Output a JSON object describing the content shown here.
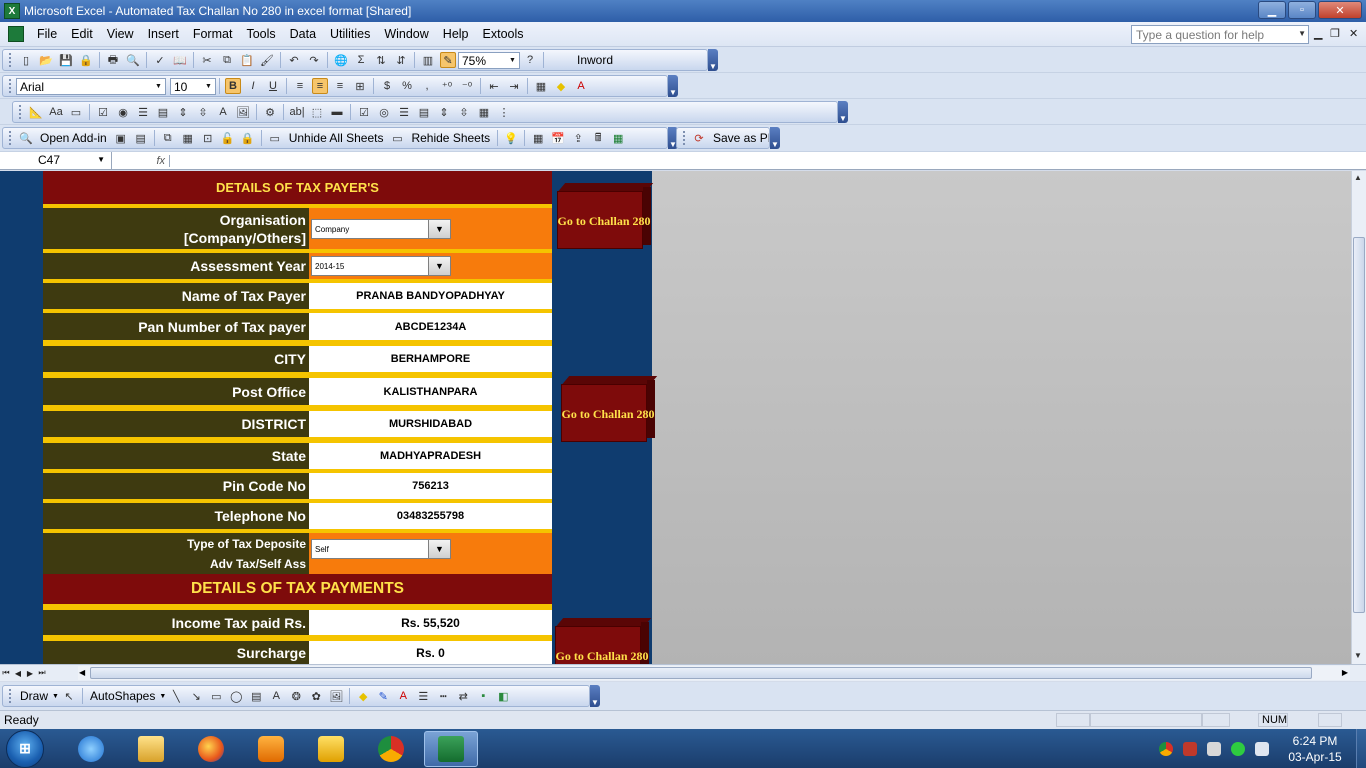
{
  "window": {
    "title": "Microsoft Excel - Automated Tax Challan No 280 in excel format  [Shared]",
    "min_glyph": "▁",
    "max_glyph": "▫",
    "close_glyph": "✕"
  },
  "menu": {
    "items": [
      "File",
      "Edit",
      "View",
      "Insert",
      "Format",
      "Tools",
      "Data",
      "Utilities",
      "Window",
      "Help",
      "Extools"
    ],
    "help_placeholder": "Type a question for help"
  },
  "toolbar": {
    "zoom": "75%",
    "inword_label": "Inword",
    "font_name": "Arial",
    "font_size": "10",
    "bold": "B",
    "italic": "I",
    "underline": "U",
    "currency": "$",
    "percent": "%",
    "open_addin": "Open Add-in",
    "unhide_sheets": "Unhide All Sheets",
    "rehide_sheets": "Rehide Sheets",
    "save_pdf": "Save as PDF"
  },
  "formula": {
    "cell_ref": "C47",
    "fx_label": "fx"
  },
  "form": {
    "section1_title": "DETAILS OF TAX PAYER'S",
    "section2_title": "DETAILS OF TAX PAYMENTS",
    "org_label_1": "Organisation",
    "org_label_2": "[Company/Others]",
    "org_value": "Company",
    "ay_label": "Assessment Year",
    "ay_value": "2014-15",
    "name_label": "Name of Tax Payer",
    "name_value": "PRANAB BANDYOPADHYAY",
    "pan_label": "Pan Number of Tax payer",
    "pan_value": "ABCDE1234A",
    "city_label": "CITY",
    "city_value": "BERHAMPORE",
    "po_label": "Post Office",
    "po_value": "KALISTHANPARA",
    "district_label": "DISTRICT",
    "district_value": "MURSHIDABAD",
    "state_label": "State",
    "state_value": "MADHYAPRADESH",
    "pin_label": "Pin Code No",
    "pin_value": "756213",
    "tel_label": "Telephone No",
    "tel_value": "03483255798",
    "dep_label_1": "Type of Tax Deposite",
    "dep_label_2": "Adv Tax/Self Ass",
    "dep_value": "Self",
    "income_label": "Income Tax paid Rs.",
    "income_value": "Rs. 55,520",
    "surcharge_label": "Surcharge",
    "surcharge_value": "Rs. 0"
  },
  "buttons": {
    "challan_1": "Go to Challan 280",
    "challan_2": "Go to Challan 280",
    "challan_3": "Go to Challan 280"
  },
  "drawbar": {
    "draw": "Draw",
    "autoshapes": "AutoShapes"
  },
  "status": {
    "text": "Ready",
    "num": "NUM"
  },
  "taskbar": {
    "time": "6:24 PM",
    "date": "03-Apr-15"
  },
  "colors": {
    "header_red": "#7e0b0b",
    "header_text": "#ffe14a",
    "label_olive": "#3e3a10",
    "accent_orange": "#f77b0c",
    "stripe_yellow": "#f5c400",
    "sheet_blue": "#0f3c6f"
  }
}
